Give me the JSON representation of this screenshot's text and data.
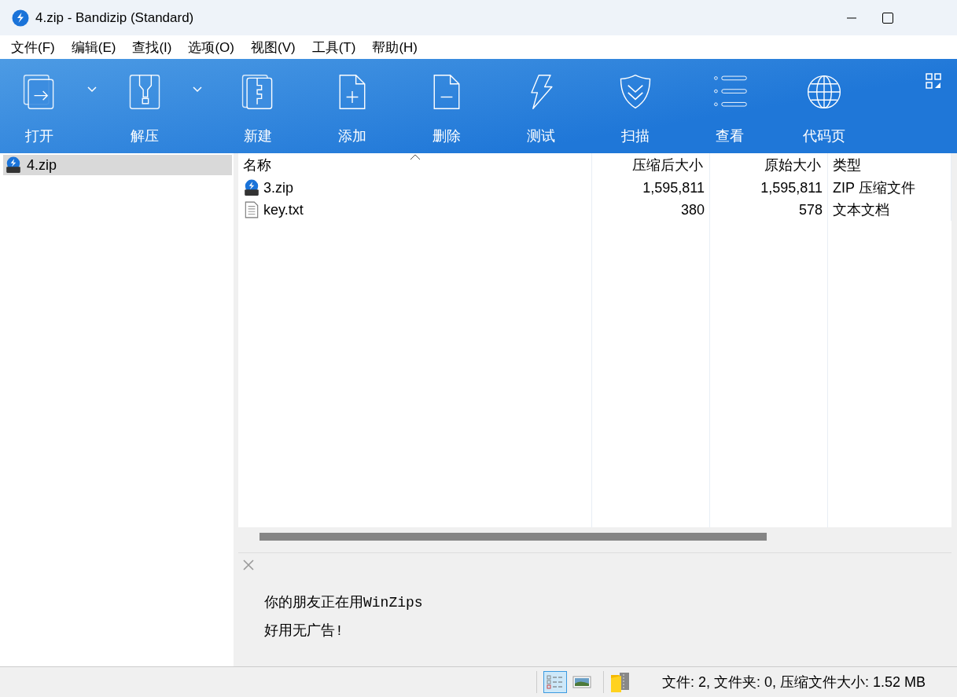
{
  "window": {
    "title": "4.zip - Bandizip (Standard)"
  },
  "menu": [
    "文件(F)",
    "编辑(E)",
    "查找(I)",
    "选项(O)",
    "视图(V)",
    "工具(T)",
    "帮助(H)"
  ],
  "toolbar": [
    {
      "label": "打开",
      "has_dropdown": true
    },
    {
      "label": "解压",
      "has_dropdown": true
    },
    {
      "label": "新建",
      "has_dropdown": false
    },
    {
      "label": "添加",
      "has_dropdown": false
    },
    {
      "label": "删除",
      "has_dropdown": false
    },
    {
      "label": "测试",
      "has_dropdown": false
    },
    {
      "label": "扫描",
      "has_dropdown": false
    },
    {
      "label": "查看",
      "has_dropdown": false
    },
    {
      "label": "代码页",
      "has_dropdown": false
    }
  ],
  "tree": [
    {
      "label": "4.zip",
      "selected": true
    }
  ],
  "table": {
    "columns": [
      {
        "label": "名称",
        "sorted": true
      },
      {
        "label": "压缩后大小",
        "sorted": false
      },
      {
        "label": "原始大小",
        "sorted": false
      },
      {
        "label": "类型",
        "sorted": false
      }
    ],
    "rows": [
      {
        "kind": "zip",
        "name": "3.zip",
        "packed": "1,595,811",
        "size": "1,595,811",
        "type": "ZIP 压缩文件",
        "selected": false
      },
      {
        "kind": "text",
        "name": "key.txt",
        "packed": "380",
        "size": "578",
        "type": "文本文档",
        "selected": false
      }
    ]
  },
  "ad": {
    "lines": [
      "你的朋友正在用WinZips",
      "好用无广告!"
    ]
  },
  "status_bar": {
    "view_buttons": [
      {
        "selected": true
      },
      {
        "selected": false
      }
    ],
    "text": "文件: 2, 文件夹: 0, 压缩文件大小: 1.52 MB"
  }
}
